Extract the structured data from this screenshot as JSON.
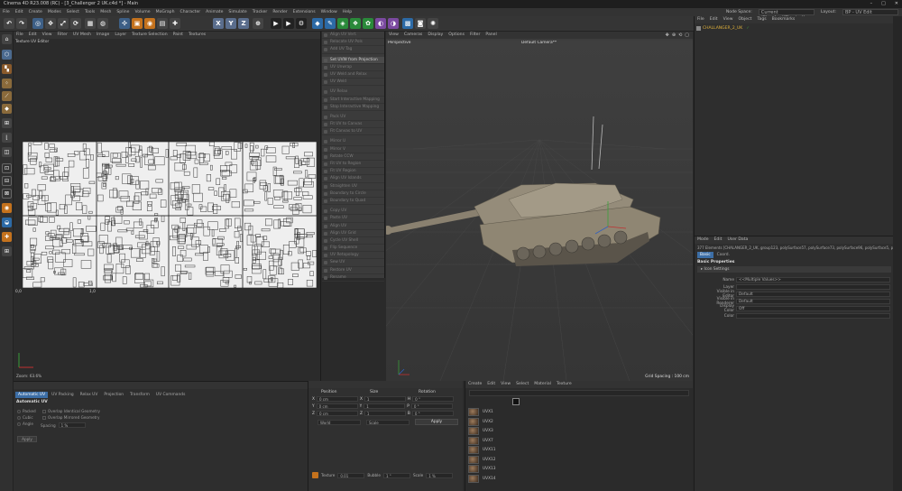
{
  "window": {
    "title": "Cinema 4D R23.008 (RC) - [3_Challenger 2 UK.c4d *] - Main"
  },
  "menubar": {
    "items": [
      "File",
      "Edit",
      "Create",
      "Modes",
      "Select",
      "Tools",
      "Mesh",
      "Spline",
      "Volume",
      "MoGraph",
      "Character",
      "Animate",
      "Simulate",
      "Tracker",
      "Render",
      "Extensions",
      "Window",
      "Help"
    ],
    "node_space_label": "Node Space:",
    "node_space_value": "Current (Standard/Physical)",
    "layout_label": "Layout:",
    "layout_value": "BP - UV Edit"
  },
  "toolbar": {
    "axis_labels": [
      "X",
      "Y",
      "Z"
    ]
  },
  "uv_editor": {
    "menu": [
      "File",
      "Edit",
      "View",
      "Filter",
      "UV Mesh",
      "Image",
      "Layer",
      "Texture Selection",
      "Paint",
      "Textures"
    ],
    "title": "Texture UV Editor",
    "origin_label": "0,0",
    "one_label": "1,0",
    "zoom_label": "Zoom: 63.6%"
  },
  "commands": [
    {
      "label": "Align UV Vert.",
      "on": false,
      "gap": false
    },
    {
      "label": "Relocate UV Pols",
      "on": false,
      "gap": false
    },
    {
      "label": "Add UV Tag",
      "on": false,
      "gap": false
    },
    {
      "label": "Set UVW from Projection",
      "on": true,
      "gap": true
    },
    {
      "label": "UV Unwrap",
      "on": false,
      "gap": false
    },
    {
      "label": "UV Weld and Relax",
      "on": false,
      "gap": false
    },
    {
      "label": "UV Weld",
      "on": false,
      "gap": false
    },
    {
      "label": "UV Relax",
      "on": false,
      "gap": true
    },
    {
      "label": "Start Interactive Mapping",
      "on": false,
      "gap": false
    },
    {
      "label": "Stop Interactive Mapping",
      "on": false,
      "gap": false
    },
    {
      "label": "Pack UV",
      "on": false,
      "gap": true
    },
    {
      "label": "Fit UV to Canvas",
      "on": false,
      "gap": false
    },
    {
      "label": "Fit Canvas to UV",
      "on": false,
      "gap": false
    },
    {
      "label": "Mirror U",
      "on": false,
      "gap": true
    },
    {
      "label": "Mirror V",
      "on": false,
      "gap": false
    },
    {
      "label": "Rotate CCW",
      "on": false,
      "gap": false
    },
    {
      "label": "Fit UV to Region",
      "on": false,
      "gap": false
    },
    {
      "label": "Fit UV Region",
      "on": false,
      "gap": false
    },
    {
      "label": "Align UV Islands",
      "on": false,
      "gap": false
    },
    {
      "label": "Straighten UV",
      "on": false,
      "gap": false
    },
    {
      "label": "Boundary to Circle",
      "on": false,
      "gap": false
    },
    {
      "label": "Boundary to Quad",
      "on": false,
      "gap": false
    },
    {
      "label": "Copy UV",
      "on": false,
      "gap": true
    },
    {
      "label": "Paste UV",
      "on": false,
      "gap": false
    },
    {
      "label": "Align UV",
      "on": false,
      "gap": false
    },
    {
      "label": "Align UV Grid",
      "on": false,
      "gap": false
    },
    {
      "label": "Cycle UV Shell",
      "on": false,
      "gap": false
    },
    {
      "label": "Flip Sequence",
      "on": false,
      "gap": false
    },
    {
      "label": "UV Retopology",
      "on": false,
      "gap": false
    },
    {
      "label": "Sew UV",
      "on": false,
      "gap": false
    },
    {
      "label": "Restore UV",
      "on": false,
      "gap": false
    },
    {
      "label": "Rename",
      "on": false,
      "gap": false
    }
  ],
  "viewport": {
    "menu": [
      "View",
      "Cameras",
      "Display",
      "Options",
      "Filter",
      "Panel"
    ],
    "name": "Perspective",
    "camera": "Default Camera**",
    "grid_spacing": "Grid Spacing : 100 cm"
  },
  "objects": {
    "menu": [
      "File",
      "Edit",
      "View",
      "Object",
      "Tags",
      "Bookmarks"
    ],
    "root": "CHALLANGER_2_UK"
  },
  "attributes": {
    "menu": [
      "Mode",
      "Edit",
      "User Data"
    ],
    "selection": "377 Elements [CHALANGER_2_UK, group123, polySurface57, polySurface73, polySurface96, polySurface5, polySurface8]",
    "tabs": [
      "Basic",
      "Coord."
    ],
    "section_title": "Basic Properties",
    "group": "Icon Settings",
    "rows": [
      {
        "label": "Name",
        "value": "<<Multiple Values>>"
      },
      {
        "label": "Layer",
        "value": ""
      },
      {
        "label": "Visible in Editor",
        "value": "Default"
      },
      {
        "label": "Visible in Renderer",
        "value": "Default"
      },
      {
        "label": "Display Color",
        "value": "Off"
      },
      {
        "label": "Color",
        "value": ""
      }
    ]
  },
  "uv_commands": {
    "tabs": [
      "Automatic UV",
      "UV Packing",
      "Relax UV",
      "Projection",
      "Transform",
      "UV Commands"
    ],
    "heading": "Automatic UV",
    "options": [
      "Packed",
      "Cubic",
      "Angle"
    ],
    "checks": [
      "Overlap Identical Geometry",
      "Overlap Mirrored Geometry"
    ],
    "spacing_label": "Spacing",
    "spacing_value": "1 %",
    "apply": "Apply"
  },
  "coords": {
    "headers": [
      "Position",
      "Size",
      "Rotation"
    ],
    "rows": [
      {
        "axis": "X",
        "pos": "0 cm",
        "size_axis": "X",
        "size": "1",
        "rot_axis": "H",
        "rot": "0 °"
      },
      {
        "axis": "Y",
        "pos": "0 cm",
        "size_axis": "Y",
        "size": "1",
        "rot_axis": "P",
        "rot": "0 °"
      },
      {
        "axis": "Z",
        "pos": "0 cm",
        "size_axis": "Z",
        "size": "1",
        "rot_axis": "B",
        "rot": "0 °"
      }
    ],
    "mode1": "World",
    "mode2": "Scale",
    "apply": "Apply",
    "texture_label": "Texture",
    "texture_value": "0.01",
    "bubble_label": "Bubble",
    "bubble_value": "1 °",
    "scale_label": "Scale",
    "scale_value": "1 %"
  },
  "materials": {
    "menu": [
      "Create",
      "Edit",
      "View",
      "Select",
      "Material",
      "Texture"
    ],
    "items": [
      "UVX1",
      "UVX2",
      "UVX3",
      "UVX7",
      "UVX11",
      "UVX12",
      "UVX13",
      "UVX14"
    ]
  },
  "colors": {
    "accent": "#3c6ea6",
    "uv_bg": "#efefef",
    "object_tag": "#e2b33c"
  }
}
